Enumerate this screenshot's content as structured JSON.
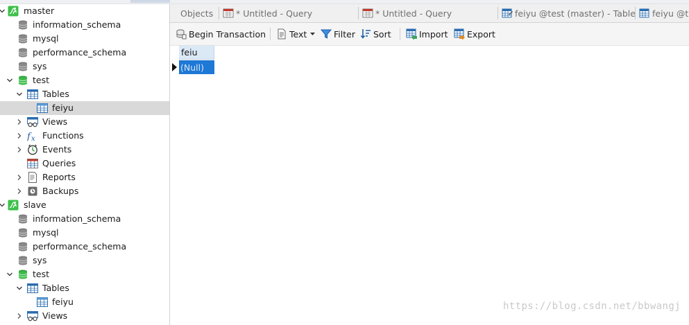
{
  "sidebar": {
    "items": [
      {
        "label": "master",
        "icon": "mysql-connection-icon",
        "level": 0,
        "state": "expanded"
      },
      {
        "label": "information_schema",
        "icon": "database-icon",
        "level": 1,
        "state": "none"
      },
      {
        "label": "mysql",
        "icon": "database-icon",
        "level": 1,
        "state": "none"
      },
      {
        "label": "performance_schema",
        "icon": "database-icon",
        "level": 1,
        "state": "none"
      },
      {
        "label": "sys",
        "icon": "database-icon",
        "level": 1,
        "state": "none"
      },
      {
        "label": "test",
        "icon": "database-open-icon",
        "level": 1,
        "state": "expanded"
      },
      {
        "label": "Tables",
        "icon": "tables-icon",
        "level": 2,
        "state": "expanded"
      },
      {
        "label": "feiyu",
        "icon": "table-icon",
        "level": 3,
        "state": "none",
        "selected": true
      },
      {
        "label": "Views",
        "icon": "views-icon",
        "level": 2,
        "state": "collapsed"
      },
      {
        "label": "Functions",
        "icon": "function-icon",
        "level": 2,
        "state": "collapsed"
      },
      {
        "label": "Events",
        "icon": "events-icon",
        "level": 2,
        "state": "collapsed"
      },
      {
        "label": "Queries",
        "icon": "queries-icon",
        "level": 2,
        "state": "none"
      },
      {
        "label": "Reports",
        "icon": "reports-icon",
        "level": 2,
        "state": "collapsed"
      },
      {
        "label": "Backups",
        "icon": "backups-icon",
        "level": 2,
        "state": "collapsed"
      },
      {
        "label": "slave",
        "icon": "mysql-connection-icon",
        "level": 0,
        "state": "expanded"
      },
      {
        "label": "information_schema",
        "icon": "database-icon",
        "level": 1,
        "state": "none"
      },
      {
        "label": "mysql",
        "icon": "database-icon",
        "level": 1,
        "state": "none"
      },
      {
        "label": "performance_schema",
        "icon": "database-icon",
        "level": 1,
        "state": "none"
      },
      {
        "label": "sys",
        "icon": "database-icon",
        "level": 1,
        "state": "none"
      },
      {
        "label": "test",
        "icon": "database-open-icon",
        "level": 1,
        "state": "expanded"
      },
      {
        "label": "Tables",
        "icon": "tables-icon",
        "level": 2,
        "state": "expanded"
      },
      {
        "label": "feiyu",
        "icon": "table-icon",
        "level": 3,
        "state": "none"
      },
      {
        "label": "Views",
        "icon": "views-icon",
        "level": 2,
        "state": "collapsed"
      }
    ]
  },
  "tabs": [
    {
      "label": "Objects",
      "icon": ""
    },
    {
      "label": "* Untitled - Query",
      "icon": "query-tab-icon"
    },
    {
      "label": "* Untitled - Query",
      "icon": "query-tab-icon"
    },
    {
      "label": "feiyu @test (master) - Table",
      "icon": "table-tab-icon"
    },
    {
      "label": "feiyu @te",
      "icon": "table-tab-icon"
    }
  ],
  "toolbar": {
    "begin_transaction": "Begin Transaction",
    "text": "Text",
    "filter": "Filter",
    "sort": "Sort",
    "import": "Import",
    "export": "Export"
  },
  "grid": {
    "columns": [
      "feiu"
    ],
    "rows": [
      [
        "(Null)"
      ]
    ]
  },
  "watermark": "https://blog.csdn.net/bbwangj",
  "colors": {
    "selected_cell": "#1e78d6",
    "header_cell": "#dbe9f7",
    "selected_row": "#d9d9d9",
    "db_open_green": "#3dbb4a",
    "db_gray": "#7b7b7b"
  }
}
